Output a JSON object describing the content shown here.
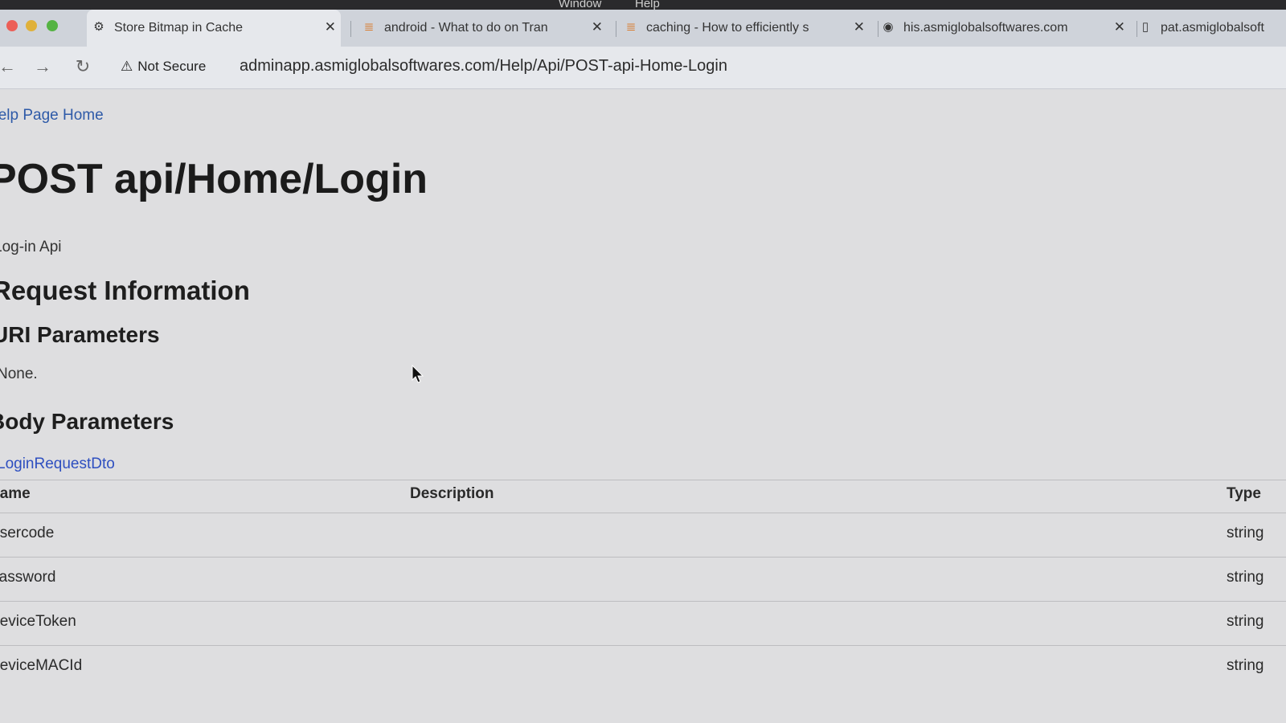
{
  "menubar": {
    "window": "Window",
    "help": "Help"
  },
  "tabs": [
    {
      "title": "Store Bitmap in Cache",
      "icon": "openai-icon",
      "active": true
    },
    {
      "title": "android - What to do on Tran",
      "icon": "stackoverflow-icon",
      "active": false
    },
    {
      "title": "caching - How to efficiently s",
      "icon": "stackoverflow-icon",
      "active": false
    },
    {
      "title": "his.asmiglobalsoftwares.com",
      "icon": "globe-icon",
      "active": false
    },
    {
      "title": "pat.asmiglobalsoft",
      "icon": "page-icon",
      "active": false
    }
  ],
  "toolbar": {
    "security_label": "Not Secure",
    "url": "adminapp.asmiglobalsoftwares.com/Help/Api/POST-api-Home-Login"
  },
  "page": {
    "breadcrumb": "Help Page Home",
    "title": "POST api/Home/Login",
    "description": "Log-in Api",
    "request_heading": "Request Information",
    "uri_heading": "URI Parameters",
    "uri_none": "None.",
    "body_heading": "Body Parameters",
    "body_type_link": "LoginRequestDto",
    "table": {
      "headers": {
        "name": "Name",
        "description": "Description",
        "type": "Type"
      },
      "rows": [
        {
          "name": "Usercode",
          "description": "",
          "type": "string"
        },
        {
          "name": "Password",
          "description": "",
          "type": "string"
        },
        {
          "name": "DeviceToken",
          "description": "",
          "type": "string"
        },
        {
          "name": "DeviceMACId",
          "description": "",
          "type": "string"
        }
      ]
    }
  },
  "colors": {
    "link": "#2e5aa8",
    "tabstrip": "#cfd3da",
    "page_bg": "#dedee0"
  }
}
